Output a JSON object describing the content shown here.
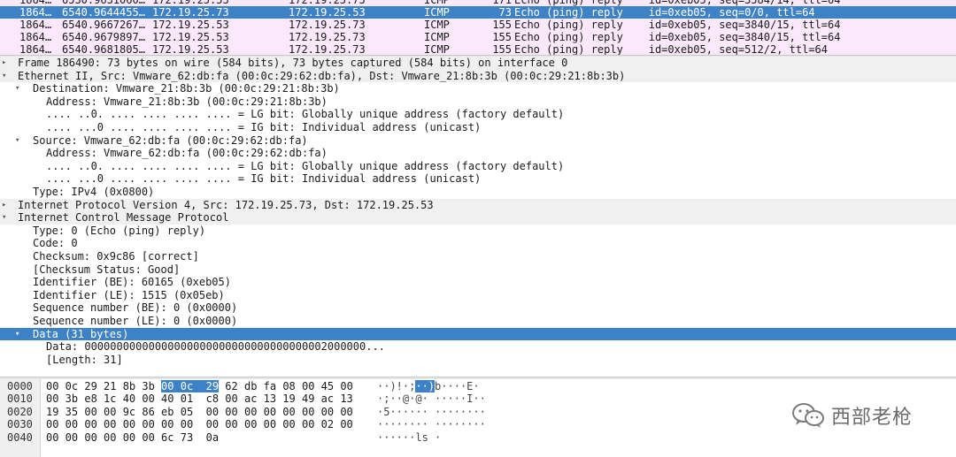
{
  "packet_list": {
    "rows": [
      {
        "no": "1864…",
        "time": "6530.9631060…",
        "src": "172.19.25.53",
        "dst": "172.19.25.73",
        "proto": "ICMP",
        "len": "171",
        "info": "Echo (ping) reply    id=0xeb05, seq=3584/14, ttl=64",
        "selected": false
      },
      {
        "no": "1864…",
        "time": "6540.9644455…",
        "src": "172.19.25.73",
        "dst": "172.19.25.53",
        "proto": "ICMP",
        "len": "73",
        "info": "Echo (ping) reply    id=0xeb05, seq=0/0, ttl=64",
        "selected": true
      },
      {
        "no": "1864…",
        "time": "6540.9667267…",
        "src": "172.19.25.53",
        "dst": "172.19.25.73",
        "proto": "ICMP",
        "len": "155",
        "info": "Echo (ping) reply    id=0xeb05, seq=3840/15, ttl=64",
        "selected": false
      },
      {
        "no": "1864…",
        "time": "6540.9679897…",
        "src": "172.19.25.53",
        "dst": "172.19.25.73",
        "proto": "ICMP",
        "len": "155",
        "info": "Echo (ping) reply    id=0xeb05, seq=3840/15, ttl=64",
        "selected": false
      },
      {
        "no": "1864…",
        "time": "6540.9681805…",
        "src": "172.19.25.53",
        "dst": "172.19.25.73",
        "proto": "ICMP",
        "len": "155",
        "info": "Echo (ping) reply    id=0xeb05, seq=512/2, ttl=64",
        "selected": false
      }
    ]
  },
  "details": {
    "rows": [
      {
        "level": 0,
        "state": "collapsed",
        "text": "Frame 186490: 73 bytes on wire (584 bits), 73 bytes captured (584 bits) on interface 0"
      },
      {
        "level": 0,
        "state": "expanded",
        "text": "Ethernet II, Src: Vmware_62:db:fa (00:0c:29:62:db:fa), Dst: Vmware_21:8b:3b (00:0c:29:21:8b:3b)"
      },
      {
        "level": 1,
        "state": "expanded",
        "text": "Destination: Vmware_21:8b:3b (00:0c:29:21:8b:3b)"
      },
      {
        "level": 2,
        "state": "leaf",
        "text": "Address: Vmware_21:8b:3b (00:0c:29:21:8b:3b)"
      },
      {
        "level": 2,
        "state": "leaf",
        "text": ".... ..0. .... .... .... .... = LG bit: Globally unique address (factory default)"
      },
      {
        "level": 2,
        "state": "leaf",
        "text": ".... ...0 .... .... .... .... = IG bit: Individual address (unicast)"
      },
      {
        "level": 1,
        "state": "expanded",
        "text": "Source: Vmware_62:db:fa (00:0c:29:62:db:fa)"
      },
      {
        "level": 2,
        "state": "leaf",
        "text": "Address: Vmware_62:db:fa (00:0c:29:62:db:fa)"
      },
      {
        "level": 2,
        "state": "leaf",
        "text": ".... ..0. .... .... .... .... = LG bit: Globally unique address (factory default)"
      },
      {
        "level": 2,
        "state": "leaf",
        "text": ".... ...0 .... .... .... .... = IG bit: Individual address (unicast)"
      },
      {
        "level": 1,
        "state": "leaf",
        "text": "Type: IPv4 (0x0800)"
      },
      {
        "level": 0,
        "state": "collapsed",
        "text": "Internet Protocol Version 4, Src: 172.19.25.73, Dst: 172.19.25.53"
      },
      {
        "level": 0,
        "state": "expanded",
        "text": "Internet Control Message Protocol"
      },
      {
        "level": 1,
        "state": "leaf",
        "text": "Type: 0 (Echo (ping) reply)"
      },
      {
        "level": 1,
        "state": "leaf",
        "text": "Code: 0"
      },
      {
        "level": 1,
        "state": "leaf",
        "text": "Checksum: 0x9c86 [correct]"
      },
      {
        "level": 1,
        "state": "leaf",
        "text": "[Checksum Status: Good]"
      },
      {
        "level": 1,
        "state": "leaf",
        "text": "Identifier (BE): 60165 (0xeb05)"
      },
      {
        "level": 1,
        "state": "leaf",
        "text": "Identifier (LE): 1515 (0x05eb)"
      },
      {
        "level": 1,
        "state": "leaf",
        "text": "Sequence number (BE): 0 (0x0000)"
      },
      {
        "level": 1,
        "state": "leaf",
        "text": "Sequence number (LE): 0 (0x0000)"
      },
      {
        "level": 1,
        "state": "expanded",
        "text": "Data (31 bytes)",
        "selected": true
      },
      {
        "level": 2,
        "state": "leaf",
        "text": "Data: 00000000000000000000000000000000000002000000..."
      },
      {
        "level": 2,
        "state": "leaf",
        "text": "[Length: 31]"
      }
    ]
  },
  "bytes": {
    "rows": [
      {
        "offset": "0000",
        "hex_pre": "00 0c 29 21 8b 3b ",
        "hex_hl": "00 0c  29",
        "hex_post": " 62 db fa 08 00 45 00",
        "ascii_pre": "··)!·;",
        "ascii_hl": "··)",
        "ascii_post": "b····E·"
      },
      {
        "offset": "0010",
        "hex_pre": "00 3b e8 1c 40 00 40 01  c8 00 ac 13 19 49 ac 13",
        "hex_hl": "",
        "hex_post": "",
        "ascii_pre": "·;··@·@· ·····I··",
        "ascii_hl": "",
        "ascii_post": ""
      },
      {
        "offset": "0020",
        "hex_pre": "19 35 00 00 9c 86 eb 05  00 00 00 00 00 00 00 00",
        "hex_hl": "",
        "hex_post": "",
        "ascii_pre": "·5······ ········",
        "ascii_hl": "",
        "ascii_post": ""
      },
      {
        "offset": "0030",
        "hex_pre": "00 00 00 00 00 00 00 00  00 00 00 00 00 00 02 00",
        "hex_hl": "",
        "hex_post": "",
        "ascii_pre": "········ ········",
        "ascii_hl": "",
        "ascii_post": ""
      },
      {
        "offset": "0040",
        "hex_pre": "00 00 00 00 00 00 6c 73  0a",
        "hex_hl": "",
        "hex_post": "",
        "ascii_pre": "······ls ·",
        "ascii_hl": "",
        "ascii_post": ""
      }
    ]
  },
  "watermark": {
    "text": "西部老枪",
    "icon": "wechat-icon"
  },
  "colors": {
    "selection": "#3d82c6",
    "packet_row_bg": "#fce8fb",
    "toplevel_row_bg": "#f0f0f0"
  }
}
